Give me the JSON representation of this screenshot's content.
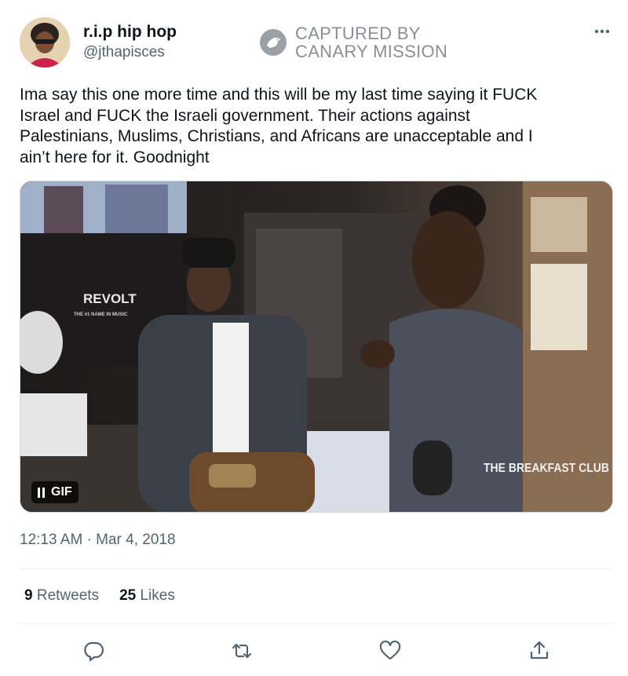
{
  "author": {
    "display_name": "r.i.p hip hop",
    "handle": "@jthapisces"
  },
  "watermark": {
    "line1": "CAPTURED BY",
    "line2": "CANARY MISSION"
  },
  "tweet": {
    "text": "Ima say this one more time and this will be my last time saying it FUCK\nIsrael and FUCK the Israeli government. Their actions against\nPalestinians, Muslims, Christians, and Africans are unacceptable and I\nain’t here for it. Goodnight",
    "timestamp": "12:13 AM · Mar 4, 2018"
  },
  "media": {
    "badge_label": "GIF",
    "overlay_revolt": "REVOLT",
    "overlay_tagline": "THE #1 NAME IN MUSIC",
    "overlay_show": "THE BREAKFAST CLUB"
  },
  "stats": {
    "retweets_count": "9",
    "retweets_label": "Retweets",
    "likes_count": "25",
    "likes_label": "Likes"
  },
  "actions": [
    "reply-icon",
    "retweet-icon",
    "like-icon",
    "share-icon"
  ],
  "colors": {
    "text": "#0f1419",
    "secondary": "#536471",
    "divider": "#eff3f4"
  }
}
